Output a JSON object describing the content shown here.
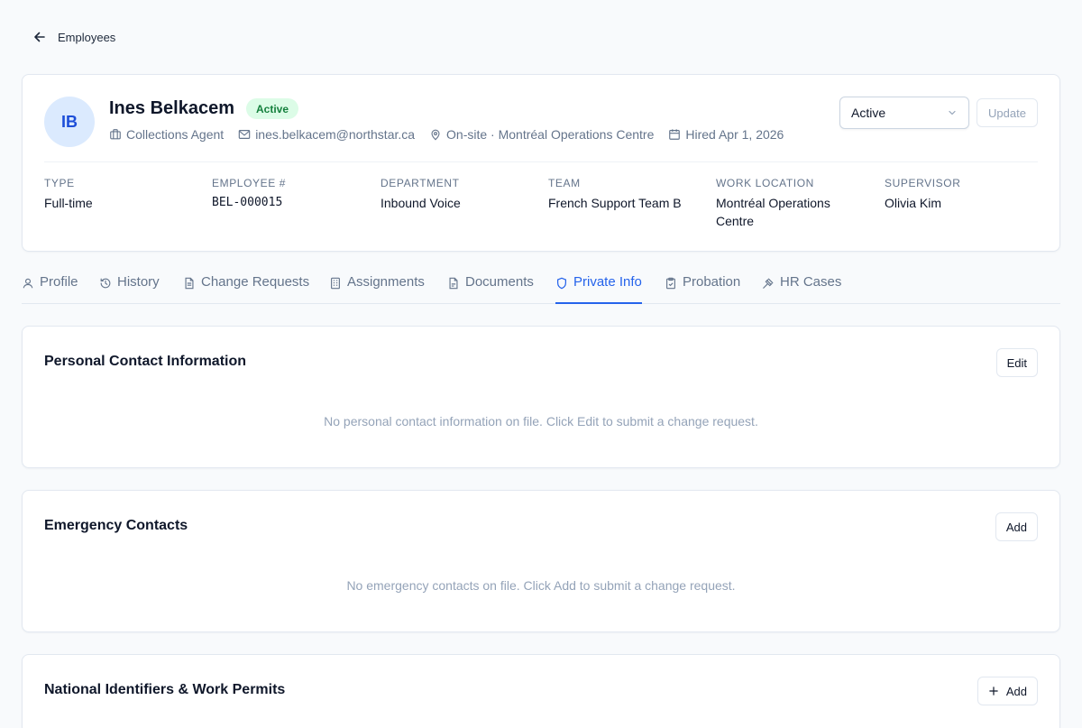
{
  "back": {
    "label": "Employees"
  },
  "employee": {
    "initials": "IB",
    "name": "Ines Belkacem",
    "status_badge": "Active",
    "job_title": "Collections Agent",
    "email": "ines.belkacem@northstar.ca",
    "location": "On-site · Montréal Operations Centre",
    "hired": "Hired Apr 1, 2026"
  },
  "status_select": {
    "value": "Active"
  },
  "update_button": "Update",
  "fields": [
    {
      "label": "Type",
      "value": "Full-time"
    },
    {
      "label": "Employee #",
      "value": "BEL-000015"
    },
    {
      "label": "Department",
      "value": "Inbound Voice"
    },
    {
      "label": "Team",
      "value": "French Support Team B"
    },
    {
      "label": "Work Location",
      "value": "Montréal Operations Centre"
    },
    {
      "label": "Supervisor",
      "value": "Olivia Kim"
    }
  ],
  "tabs": [
    {
      "label": "Profile",
      "icon": "user-icon"
    },
    {
      "label": "History",
      "icon": "history-icon"
    },
    {
      "label": "Change Requests",
      "icon": "file-text-icon"
    },
    {
      "label": "Assignments",
      "icon": "building-icon"
    },
    {
      "label": "Documents",
      "icon": "file-icon"
    },
    {
      "label": "Private Info",
      "icon": "shield-icon",
      "active": true
    },
    {
      "label": "Probation",
      "icon": "clipboard-icon"
    },
    {
      "label": "HR Cases",
      "icon": "gavel-icon"
    }
  ],
  "sections": [
    {
      "title": "Personal Contact Information",
      "button": "Edit",
      "empty": "No personal contact information on file. Click Edit to submit a change request."
    },
    {
      "title": "Emergency Contacts",
      "button": "Add",
      "empty": "No emergency contacts on file. Click Add to submit a change request."
    },
    {
      "title": "National Identifiers & Work Permits",
      "button": "Add"
    }
  ],
  "colors": {
    "accent": "#2563eb",
    "badge_bg": "#dcfce7",
    "badge_text": "#15803d",
    "avatar_bg": "#dbeafe"
  }
}
